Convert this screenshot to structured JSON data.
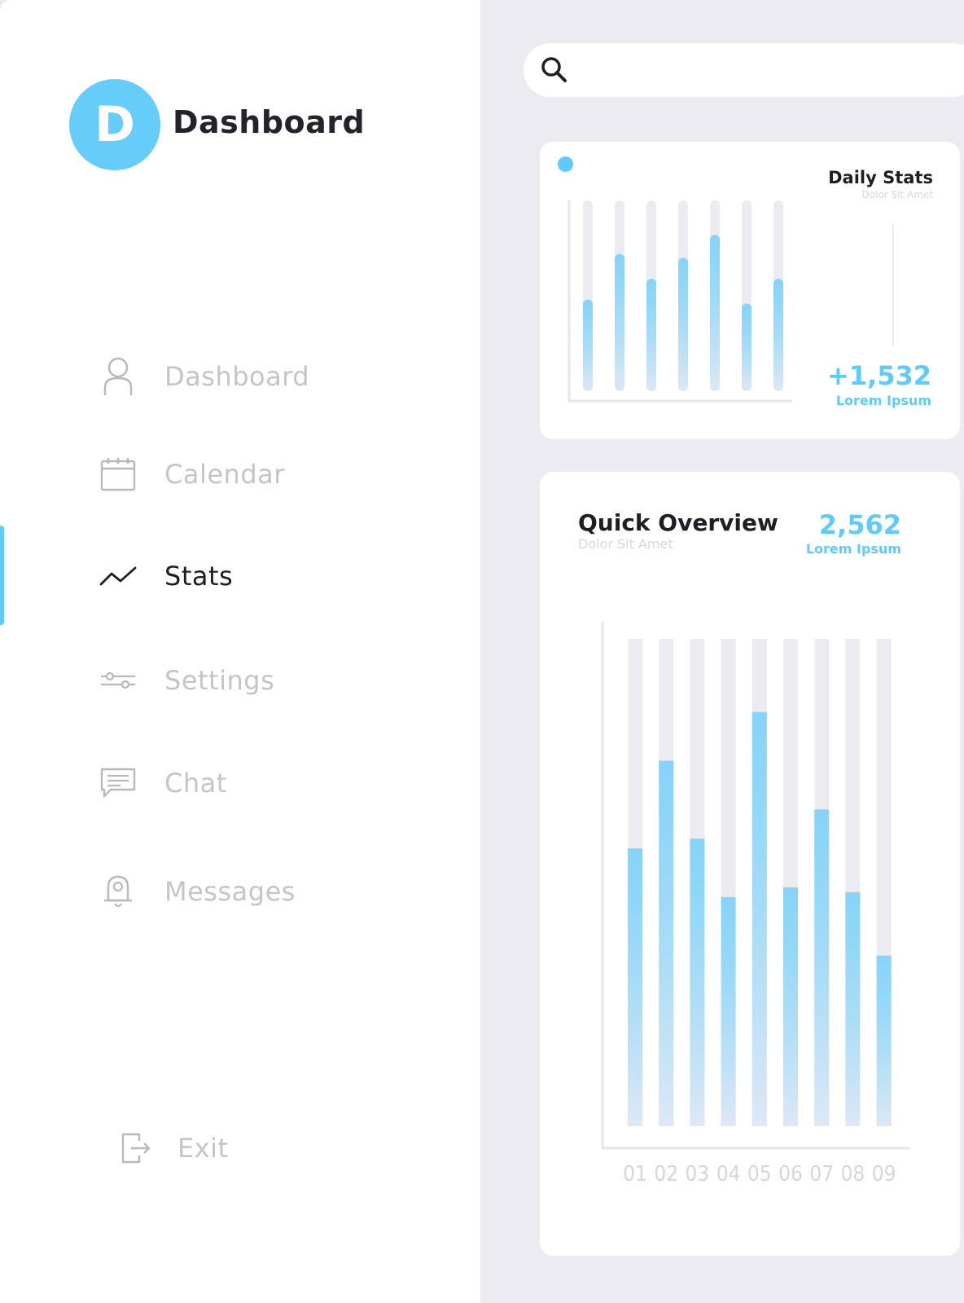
{
  "brand": {
    "logo_letter": "D",
    "title": "Dashboard"
  },
  "nav": {
    "items": [
      {
        "label": "Dashboard",
        "icon": "user-icon",
        "active": false
      },
      {
        "label": "Calendar",
        "icon": "calendar-icon",
        "active": false
      },
      {
        "label": "Stats",
        "icon": "trend-line-icon",
        "active": true
      },
      {
        "label": "Settings",
        "icon": "sliders-icon",
        "active": false
      },
      {
        "label": "Chat",
        "icon": "chat-icon",
        "active": false
      },
      {
        "label": "Messages",
        "icon": "bell-icon",
        "active": false
      }
    ],
    "exit_label": "Exit"
  },
  "search": {
    "placeholder": "",
    "value": ""
  },
  "daily_stats": {
    "title": "Daily Stats",
    "subtitle": "Dolor Sit Amet",
    "value": "+1,532",
    "value_label": "Lorem Ipsum"
  },
  "quick_overview": {
    "title": "Quick Overview",
    "subtitle": "Dolor Sit Amet",
    "value": "2,562",
    "value_label": "Lorem Ipsum"
  },
  "colors": {
    "accent": "#5ecbfa",
    "bar_track": "#ebebf1",
    "background": "#ebebf1"
  },
  "chart_data": [
    {
      "type": "bar",
      "categories": [
        "",
        "",
        "",
        "",
        "",
        "",
        ""
      ],
      "values": [
        48,
        72,
        59,
        70,
        82,
        46,
        59
      ],
      "ylim": [
        0,
        100
      ],
      "grid": false
    },
    {
      "type": "bar",
      "categories": [
        "01",
        "02",
        "03",
        "04",
        "05",
        "06",
        "07",
        "08",
        "09"
      ],
      "values": [
        57,
        75,
        59,
        47,
        85,
        49,
        65,
        48,
        35
      ],
      "ylim": [
        0,
        100
      ],
      "grid": false
    }
  ]
}
